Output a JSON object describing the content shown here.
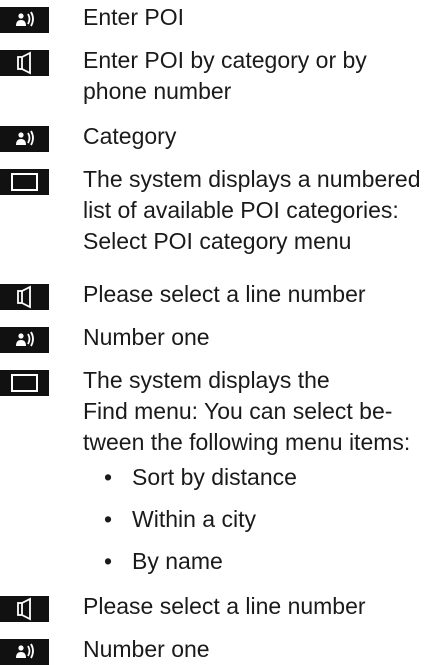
{
  "steps": [
    {
      "type": "voice",
      "icon": "voice-command-icon",
      "lines": [
        "Enter POI"
      ]
    },
    {
      "type": "speaker",
      "icon": "system-response-icon",
      "lines": [
        "Enter POI by category or by",
        "phone number"
      ]
    },
    {
      "type": "voice",
      "icon": "voice-command-icon",
      "lines": [
        "Category"
      ]
    },
    {
      "type": "display",
      "icon": "display-screen-icon",
      "lines": [
        "The system displays a numbered",
        "list of available POI categories:",
        "Select POI category menu"
      ]
    },
    {
      "type": "speaker",
      "icon": "system-response-icon",
      "lines": [
        "Please select a line number"
      ]
    },
    {
      "type": "voice",
      "icon": "voice-command-icon",
      "lines": [
        "Number one"
      ]
    },
    {
      "type": "display",
      "icon": "display-screen-icon",
      "lines": [
        "The system displays the",
        "Find menu: You can select be-",
        "tween the following menu items:"
      ]
    },
    {
      "type": "speaker",
      "icon": "system-response-icon",
      "lines": [
        "Please select a line number"
      ]
    },
    {
      "type": "voice",
      "icon": "voice-command-icon",
      "lines": [
        "Number one"
      ]
    }
  ],
  "bullet_symbol": "•",
  "menu_items": [
    "Sort by distance",
    "Within a city",
    "By name"
  ]
}
